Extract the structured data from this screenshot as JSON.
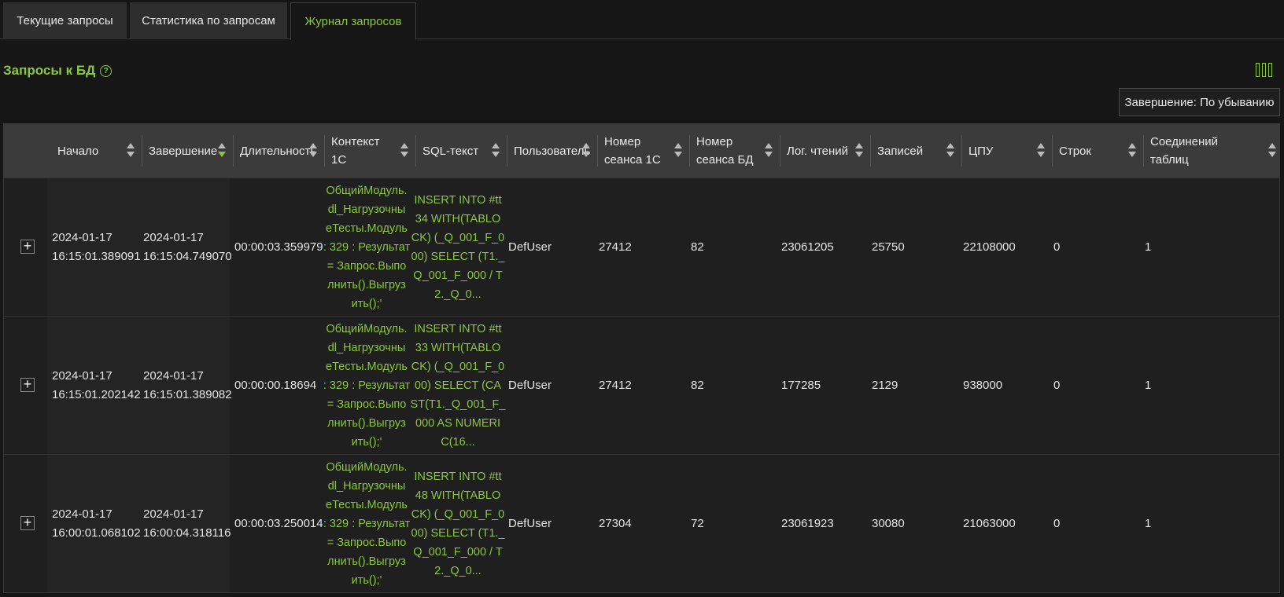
{
  "tabs": [
    {
      "label": "Текущие запросы",
      "active": false
    },
    {
      "label": "Статистика по запросам",
      "active": false
    },
    {
      "label": "Журнал запросов",
      "active": true
    }
  ],
  "section": {
    "title": "Запросы к БД",
    "help_icon": "question-circle-icon",
    "columns_icon": "columns-icon"
  },
  "sort_badge": "Завершение: По убыванию",
  "colors": {
    "accent": "#8cc63f",
    "bg": "#161616",
    "header_bg": "#3b3b3b"
  },
  "columns": [
    {
      "label": "Начало"
    },
    {
      "label": "Завершение",
      "sorted": "desc"
    },
    {
      "label": "Длительность"
    },
    {
      "label": "Контекст\n1С"
    },
    {
      "label": "SQL-текст"
    },
    {
      "label": "Пользователь"
    },
    {
      "label": "Номер\nсеанса 1С"
    },
    {
      "label": "Номер\nсеанса БД"
    },
    {
      "label": "Лог. чтений"
    },
    {
      "label": "Записей"
    },
    {
      "label": "ЦПУ"
    },
    {
      "label": "Строк"
    },
    {
      "label": "Соединений\nтаблиц"
    }
  ],
  "rows": [
    {
      "start": "2024-01-17\n16:15:01.389091",
      "end": "2024-01-17\n16:15:04.749070",
      "duration": "00:00:03.359979",
      "context": "ОбщийМодуль.\ndl_Нагрузочны\nеТесты.Модуль\n: 329 : Результат\n= Запрос.Выпо\nлнить().Выгруз\nить();'",
      "sql": "INSERT INTO #tt\n34 WITH(TABLO\nCK) (_Q_001_F_0\n00) SELECT (T1._\nQ_001_F_000 / T\n2._Q_0...",
      "user": "DefUser",
      "session1c": "27412",
      "sessiondb": "82",
      "reads": "23061205",
      "writes": "25750",
      "cpu": "22108000",
      "rows": "0",
      "joins": "1"
    },
    {
      "start": "2024-01-17\n16:15:01.202142",
      "end": "2024-01-17\n16:15:01.389082",
      "duration": "00:00:00.18694",
      "context": "ОбщийМодуль.\ndl_Нагрузочны\nеТесты.Модуль\n: 329 : Результат\n= Запрос.Выпо\nлнить().Выгруз\nить();'",
      "sql": "INSERT INTO #tt\n33 WITH(TABLO\nCK) (_Q_001_F_0\n00) SELECT (CA\nST(T1._Q_001_F_\n000 AS NUMERI\nC(16...",
      "user": "DefUser",
      "session1c": "27412",
      "sessiondb": "82",
      "reads": "177285",
      "writes": "2129",
      "cpu": "938000",
      "rows": "0",
      "joins": "1"
    },
    {
      "start": "2024-01-17\n16:00:01.068102",
      "end": "2024-01-17\n16:00:04.318116",
      "duration": "00:00:03.250014",
      "context": "ОбщийМодуль.\ndl_Нагрузочны\nеТесты.Модуль\n: 329 : Результат\n= Запрос.Выпо\nлнить().Выгруз\nить();'",
      "sql": "INSERT INTO #tt\n48 WITH(TABLO\nCK) (_Q_001_F_0\n00) SELECT (T1._\nQ_001_F_000 / T\n2._Q_0...",
      "user": "DefUser",
      "session1c": "27304",
      "sessiondb": "72",
      "reads": "23061923",
      "writes": "30080",
      "cpu": "21063000",
      "rows": "0",
      "joins": "1"
    }
  ]
}
